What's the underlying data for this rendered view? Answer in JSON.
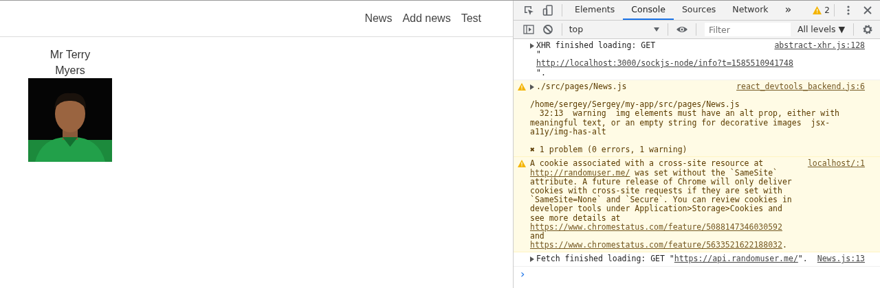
{
  "page": {
    "nav": [
      {
        "label": "News"
      },
      {
        "label": "Add news"
      },
      {
        "label": "Test"
      }
    ],
    "users": [
      {
        "name": "Mr Terry Myers"
      }
    ]
  },
  "devtools": {
    "tabs": [
      {
        "label": "Elements",
        "selected": false
      },
      {
        "label": "Console",
        "selected": true
      },
      {
        "label": "Sources",
        "selected": false
      },
      {
        "label": "Network",
        "selected": false
      }
    ],
    "more_tabs": "»",
    "warning_count": "2",
    "context": "top",
    "filter": {
      "placeholder": "Filter"
    },
    "levels": "All levels ▼",
    "messages": [
      {
        "kind": "info",
        "expandable": true,
        "parts": [
          {
            "text": "XHR finished loading: GET \""
          },
          {
            "text": "http://localhost:3000/sockjs-node/info?t=1585510941748",
            "link": true
          },
          {
            "text": "\"."
          }
        ],
        "source": "abstract-xhr.js:128"
      },
      {
        "kind": "warning",
        "expandable": true,
        "parts": [
          {
            "text": "./src/pages/News.js"
          }
        ],
        "source": "react_devtools_backend.js:6",
        "details": [
          [
            "/home/sergey/Sergey/my-app/src/pages/News.js",
            "  32:13  warning  img elements must have an alt prop, either with meaningful text, or an empty string for decorative images  jsx-a11y/img-has-alt"
          ],
          [
            "✖ 1 problem (0 errors, 1 warning)"
          ]
        ]
      },
      {
        "kind": "warning",
        "expandable": false,
        "parts": [
          {
            "text": "A cookie associated with a cross-site resource at "
          },
          {
            "text": "http://randomuser.me/",
            "link": true
          },
          {
            "text": " was set without the `SameSite` attribute. A future release of Chrome will only deliver cookies with cross-site requests if they are set with `SameSite=None` and `Secure`. You can review cookies in developer tools under Application>Storage>Cookies and see more details at "
          },
          {
            "text": "https://www.chromestatus.com/feature/5088147346030592",
            "link": true
          },
          {
            "text": " and "
          },
          {
            "text": "https://www.chromestatus.com/feature/5633521622188032",
            "link": true
          },
          {
            "text": "."
          }
        ],
        "source": "localhost/:1"
      },
      {
        "kind": "info",
        "expandable": true,
        "parts": [
          {
            "text": "Fetch finished loading: GET \""
          },
          {
            "text": "https://api.randomuser.me/",
            "link": true
          },
          {
            "text": "\"."
          }
        ],
        "source": "News.js:13"
      }
    ],
    "prompt": "›"
  }
}
